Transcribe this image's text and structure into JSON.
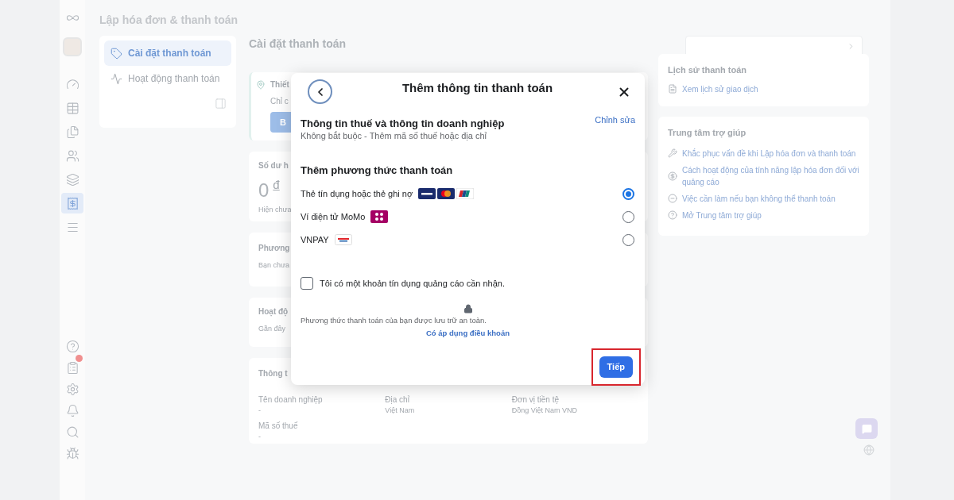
{
  "rail": {
    "top": [
      {
        "kind": "logo",
        "selected": false
      },
      {
        "kind": "avatar",
        "selected": false
      },
      {
        "kind": "gauge",
        "selected": false
      },
      {
        "kind": "table",
        "selected": false
      },
      {
        "kind": "pages",
        "selected": false
      },
      {
        "kind": "people",
        "selected": false
      },
      {
        "kind": "stack",
        "selected": false
      },
      {
        "kind": "billing",
        "selected": true
      },
      {
        "kind": "menu",
        "selected": false
      }
    ],
    "bottom": [
      {
        "kind": "help",
        "selected": false
      },
      {
        "kind": "clipboard",
        "selected": false,
        "badge": true
      },
      {
        "kind": "settings",
        "selected": false
      },
      {
        "kind": "bell",
        "selected": false
      },
      {
        "kind": "search",
        "selected": false
      },
      {
        "kind": "bug",
        "selected": false
      }
    ]
  },
  "page_title": "Lập hóa đơn & thanh toán",
  "nav": [
    {
      "label": "Cài đặt thanh toán",
      "kind": "tag",
      "selected": true
    },
    {
      "label": "Hoạt động thanh toán",
      "kind": "pulse",
      "selected": false
    }
  ],
  "section_title": "Cài đặt thanh toán",
  "setup_card": {
    "title": "Thiết",
    "text": "Chỉ c",
    "button": "B"
  },
  "balance_card": {
    "title": "Số dư h",
    "amount": "0",
    "currency": "đ",
    "note": "Hiện chưa"
  },
  "method_card": {
    "title": "Phương",
    "text": "Bạn chưa"
  },
  "activity_card": {
    "title": "Hoạt độ",
    "text": "Gần đây"
  },
  "business_card": {
    "title": "Thông t",
    "fields": [
      {
        "label": "Tên doanh nghiệp",
        "value": "-"
      },
      {
        "label": "Địa chỉ",
        "value": "Việt Nam"
      },
      {
        "label": "Đơn vị tiền tệ",
        "value": "Đồng Việt Nam VND"
      },
      {
        "label": "Mã số thuế",
        "value": "-"
      }
    ]
  },
  "history_card": {
    "title": "Lịch sử thanh toán",
    "link": "Xem lịch sử giao dịch"
  },
  "help_card": {
    "title": "Trung tâm trợ giúp",
    "links": [
      {
        "kind": "tools",
        "label": "Khắc phục vấn đề khi Lập hóa đơn và thanh toán"
      },
      {
        "kind": "coin",
        "label": "Cách hoạt động của tính năng lập hóa đơn đối với quảng cáo"
      },
      {
        "kind": "minus",
        "label": "Việc cần làm nếu bạn không thể thanh toán"
      },
      {
        "kind": "help",
        "label": "Mở Trung tâm trợ giúp"
      }
    ]
  },
  "modal": {
    "title": "Thêm thông tin thanh toán",
    "tax": {
      "title": "Thông tin thuế và thông tin doanh nghiệp",
      "subtitle": "Không bắt buộc - Thêm mã số thuế hoặc địa chỉ",
      "edit": "Chỉnh sửa"
    },
    "methods_title": "Thêm phương thức thanh toán",
    "methods": [
      {
        "label": "Thẻ tín dụng hoặc thẻ ghi nợ",
        "logos": [
          {
            "kind": "visa"
          },
          {
            "kind": "mastercard"
          },
          {
            "kind": "unionpay"
          }
        ],
        "selected": true
      },
      {
        "label": "Ví điện tử MoMo",
        "logos": [
          {
            "kind": "momo"
          }
        ],
        "selected": false
      },
      {
        "label": "VNPAY",
        "logos": [
          {
            "kind": "vnpay"
          }
        ],
        "selected": false
      }
    ],
    "credit": {
      "label": "Tôi có một khoản tín dụng quảng cáo cần nhận.",
      "checked": false
    },
    "secure_note": "Phương thức thanh toán của bạn được lưu trữ an toàn.",
    "terms_link": "Có áp dụng điều khoản",
    "next_button": "Tiếp",
    "highlighted": true
  }
}
